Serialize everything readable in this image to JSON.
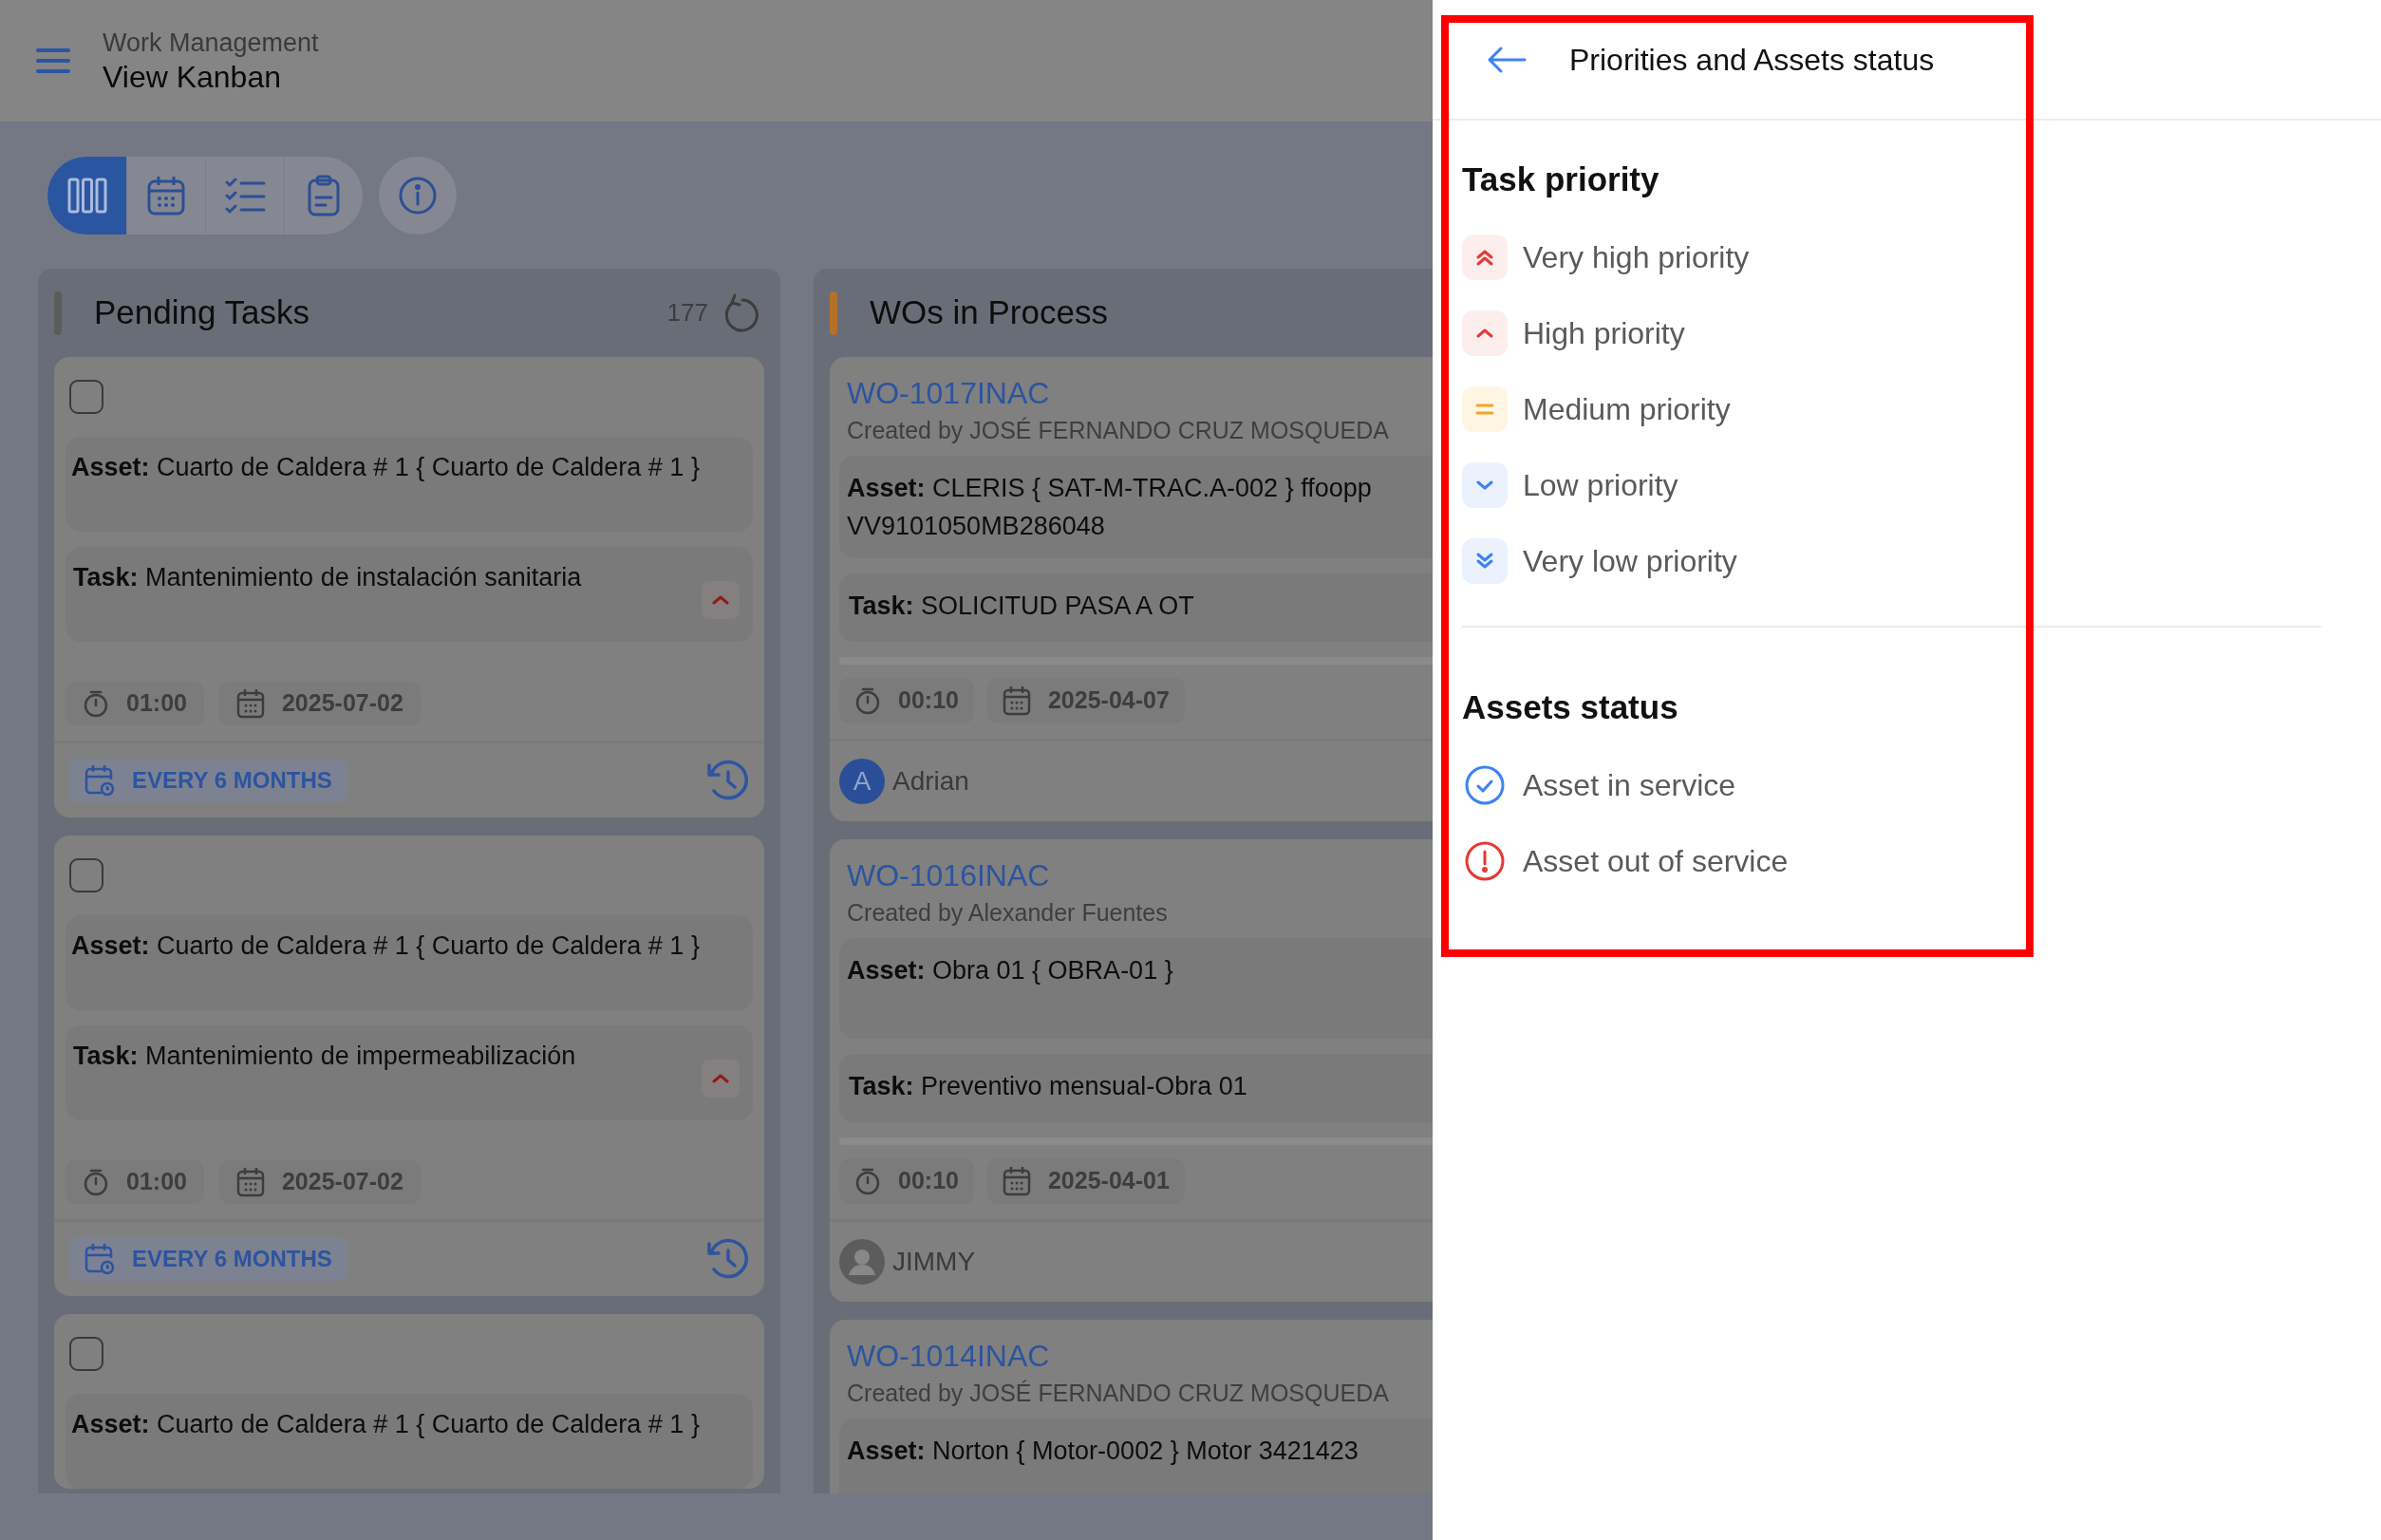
{
  "header": {
    "module": "Work Management",
    "title": "View Kanban"
  },
  "toolbar": {
    "views": [
      {
        "kind": "kanban",
        "selected": true
      },
      {
        "kind": "calendar",
        "selected": false
      },
      {
        "kind": "checklist",
        "selected": false
      },
      {
        "kind": "clipboard",
        "selected": false
      }
    ]
  },
  "columns": [
    {
      "kind": "tasks",
      "title": "Pending Tasks",
      "count": "177",
      "color": "#5c5c5c",
      "cards": [
        {
          "checked": false,
          "asset": "**Asset:** Cuarto de Caldera # 1 { Cuarto de Caldera # 1 }",
          "task": "**Task:** Mantenimiento de instalación sanitaria",
          "priority": {
            "kind": "high"
          },
          "duration": "01:00",
          "date": "2025-07-02",
          "frequency": "EVERY 6 MONTHS"
        },
        {
          "checked": false,
          "asset": "**Asset:** Cuarto de Caldera # 1 { Cuarto de Caldera # 1 }",
          "task": "**Task:** Mantenimiento de impermeabilización",
          "priority": {
            "kind": "high"
          },
          "duration": "01:00",
          "date": "2025-07-02",
          "frequency": "EVERY 6 MONTHS"
        },
        {
          "checked": false,
          "asset": "**Asset:** Cuarto de Caldera # 1 { Cuarto de Caldera # 1 }"
        }
      ]
    },
    {
      "kind": "work_orders",
      "title": "WOs in Process",
      "color": "#b5702a",
      "cards": [
        {
          "code": "WO-1017INAC",
          "created_by": "Created by JOSÉ FERNANDO CRUZ MOSQUEDA",
          "asset": "**Asset:** CLERIS { SAT-M-TRAC.A-002 } ffoopp VV9101050MB286048",
          "task": "**Task:** SOLICITUD PASA A OT",
          "duration": "00:10",
          "date": "2025-04-07",
          "assignee": {
            "kind": "initial",
            "initial": "A",
            "name": "Adrian"
          }
        },
        {
          "code": "WO-1016INAC",
          "created_by": "Created by Alexander Fuentes",
          "asset": "**Asset:** Obra 01 { OBRA-01 }",
          "task": "**Task:** Preventivo mensual-Obra 01",
          "duration": "00:10",
          "date": "2025-04-01",
          "assignee": {
            "kind": "silhouette",
            "name": "JIMMY"
          }
        },
        {
          "code": "WO-1014INAC",
          "created_by": "Created by JOSÉ FERNANDO CRUZ MOSQUEDA",
          "asset": "**Asset:** Norton { Motor-0002 } Motor 3421423"
        }
      ]
    }
  ],
  "drawer": {
    "title": "Priorities and Assets status",
    "highlighted": true,
    "sections": [
      {
        "title": "Task priority",
        "items": [
          {
            "kind": "very_high",
            "label": "Very high priority"
          },
          {
            "kind": "high",
            "label": "High priority"
          },
          {
            "kind": "medium",
            "label": "Medium priority"
          },
          {
            "kind": "low",
            "label": "Low priority"
          },
          {
            "kind": "very_low",
            "label": "Very low priority"
          }
        ]
      },
      {
        "title": "Assets status",
        "items": [
          {
            "kind": "in_service",
            "label": "Asset in service"
          },
          {
            "kind": "out_of_service",
            "label": "Asset out of service"
          }
        ]
      }
    ]
  }
}
